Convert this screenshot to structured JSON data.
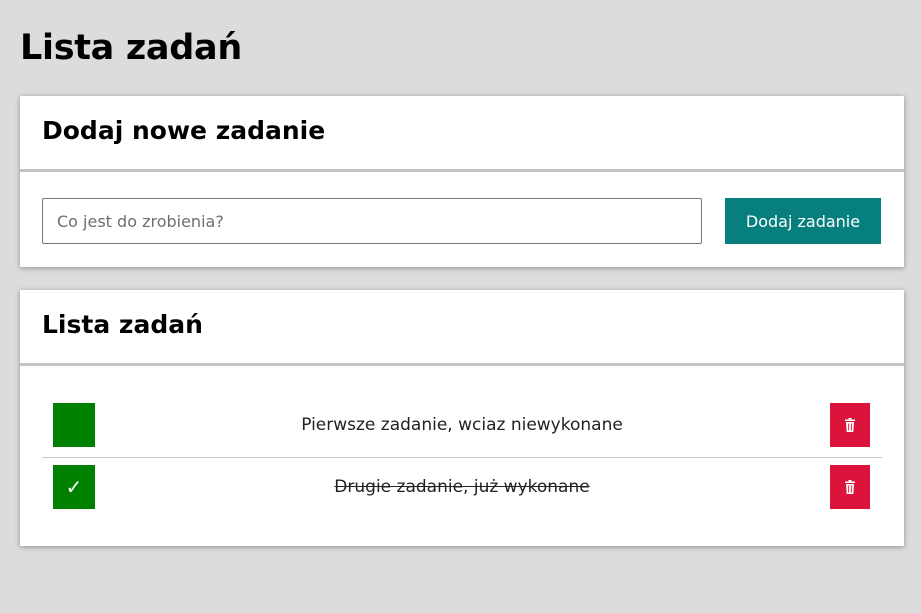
{
  "page": {
    "title": "Lista zadań"
  },
  "add_section": {
    "heading": "Dodaj nowe zadanie",
    "input_placeholder": "Co jest do zrobienia?",
    "input_value": "",
    "button_label": "Dodaj zadanie",
    "button_color": "#087f7f"
  },
  "list_section": {
    "heading": "Lista zadań",
    "tasks": [
      {
        "text": "Pierwsze zadanie, wciaz niewykonane",
        "done": false,
        "checkbox_icon": ""
      },
      {
        "text": "Drugie zadanie, już wykonane",
        "done": true,
        "checkbox_icon": "✓"
      }
    ]
  },
  "colors": {
    "checkbox": "#008000",
    "delete": "#dc143c",
    "background": "#dcdcdc"
  },
  "icons": {
    "delete": "trash-icon",
    "check": "check-icon"
  }
}
